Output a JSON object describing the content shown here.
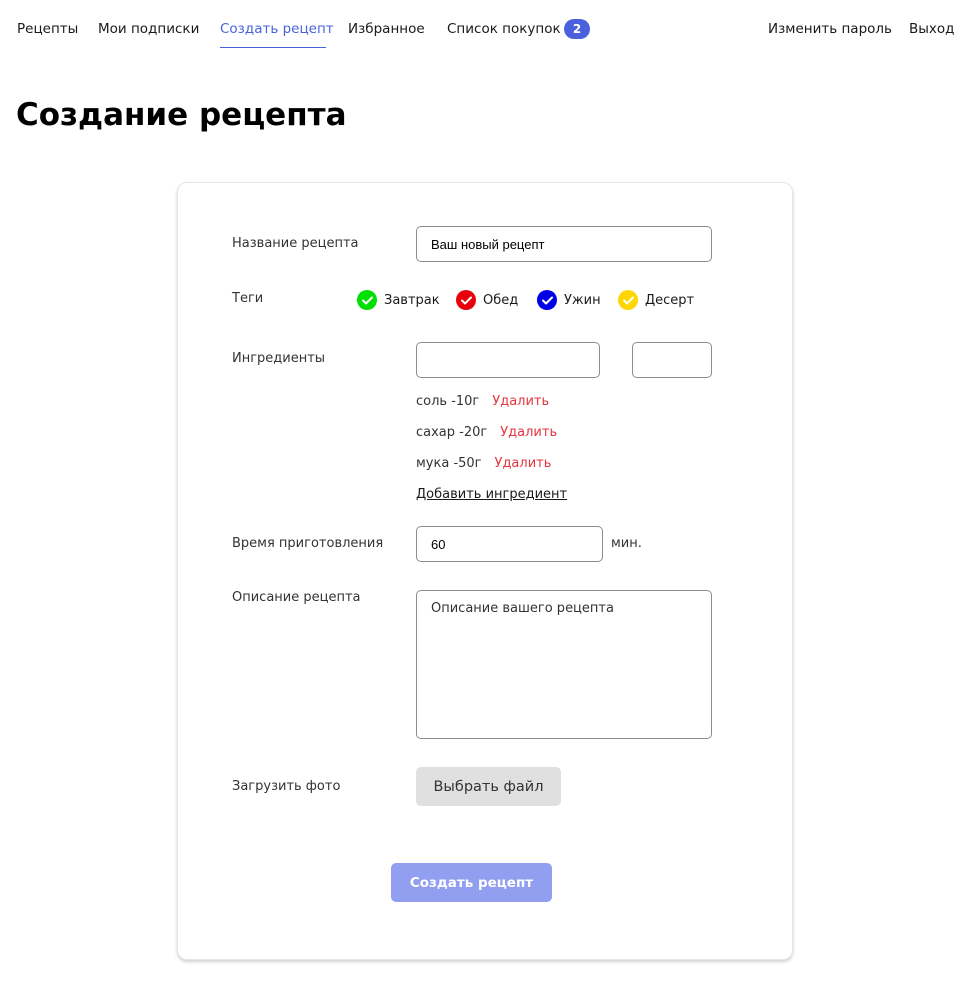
{
  "nav": {
    "items": [
      {
        "label": "Рецепты"
      },
      {
        "label": "Мои подписки"
      },
      {
        "label": "Создать рецепт"
      },
      {
        "label": "Избранное"
      },
      {
        "label": "Список покупок"
      }
    ],
    "cart_count": "2",
    "change_password": "Изменить пароль",
    "logout": "Выход",
    "active_index": 2,
    "accent_color": "#4a61dd"
  },
  "page": {
    "title": "Создание рецепта"
  },
  "form": {
    "name_label": "Название рецепта",
    "name_value": "Ваш новый рецепт",
    "tags_label": "Теги",
    "tags": [
      {
        "label": "Завтрак",
        "color": "#00e000",
        "checked": true
      },
      {
        "label": "Обед",
        "color": "#e8000b",
        "checked": true
      },
      {
        "label": "Ужин",
        "color": "#0000e6",
        "checked": true
      },
      {
        "label": "Десерт",
        "color": "#ffd600",
        "checked": true
      }
    ],
    "ingredients_label": "Ингредиенты",
    "ingredient_name_value": "",
    "ingredient_amount_value": "",
    "ingredients": [
      {
        "text": "соль -10г",
        "delete": "Удалить"
      },
      {
        "text": "сахар -20г",
        "delete": "Удалить"
      },
      {
        "text": "мука -50г",
        "delete": "Удалить"
      }
    ],
    "add_ingredient": "Добавить ингредиент",
    "time_label": "Время приготовления",
    "time_value": "60",
    "time_unit": "мин.",
    "description_label": "Описание рецепта",
    "description_placeholder": "Описание вашего рецепта",
    "photo_label": "Загрузить фото",
    "file_button": "Выбрать файл",
    "submit_button": "Создать рецепт",
    "delete_color": "#e3363f",
    "submit_color": "#929ff1"
  }
}
